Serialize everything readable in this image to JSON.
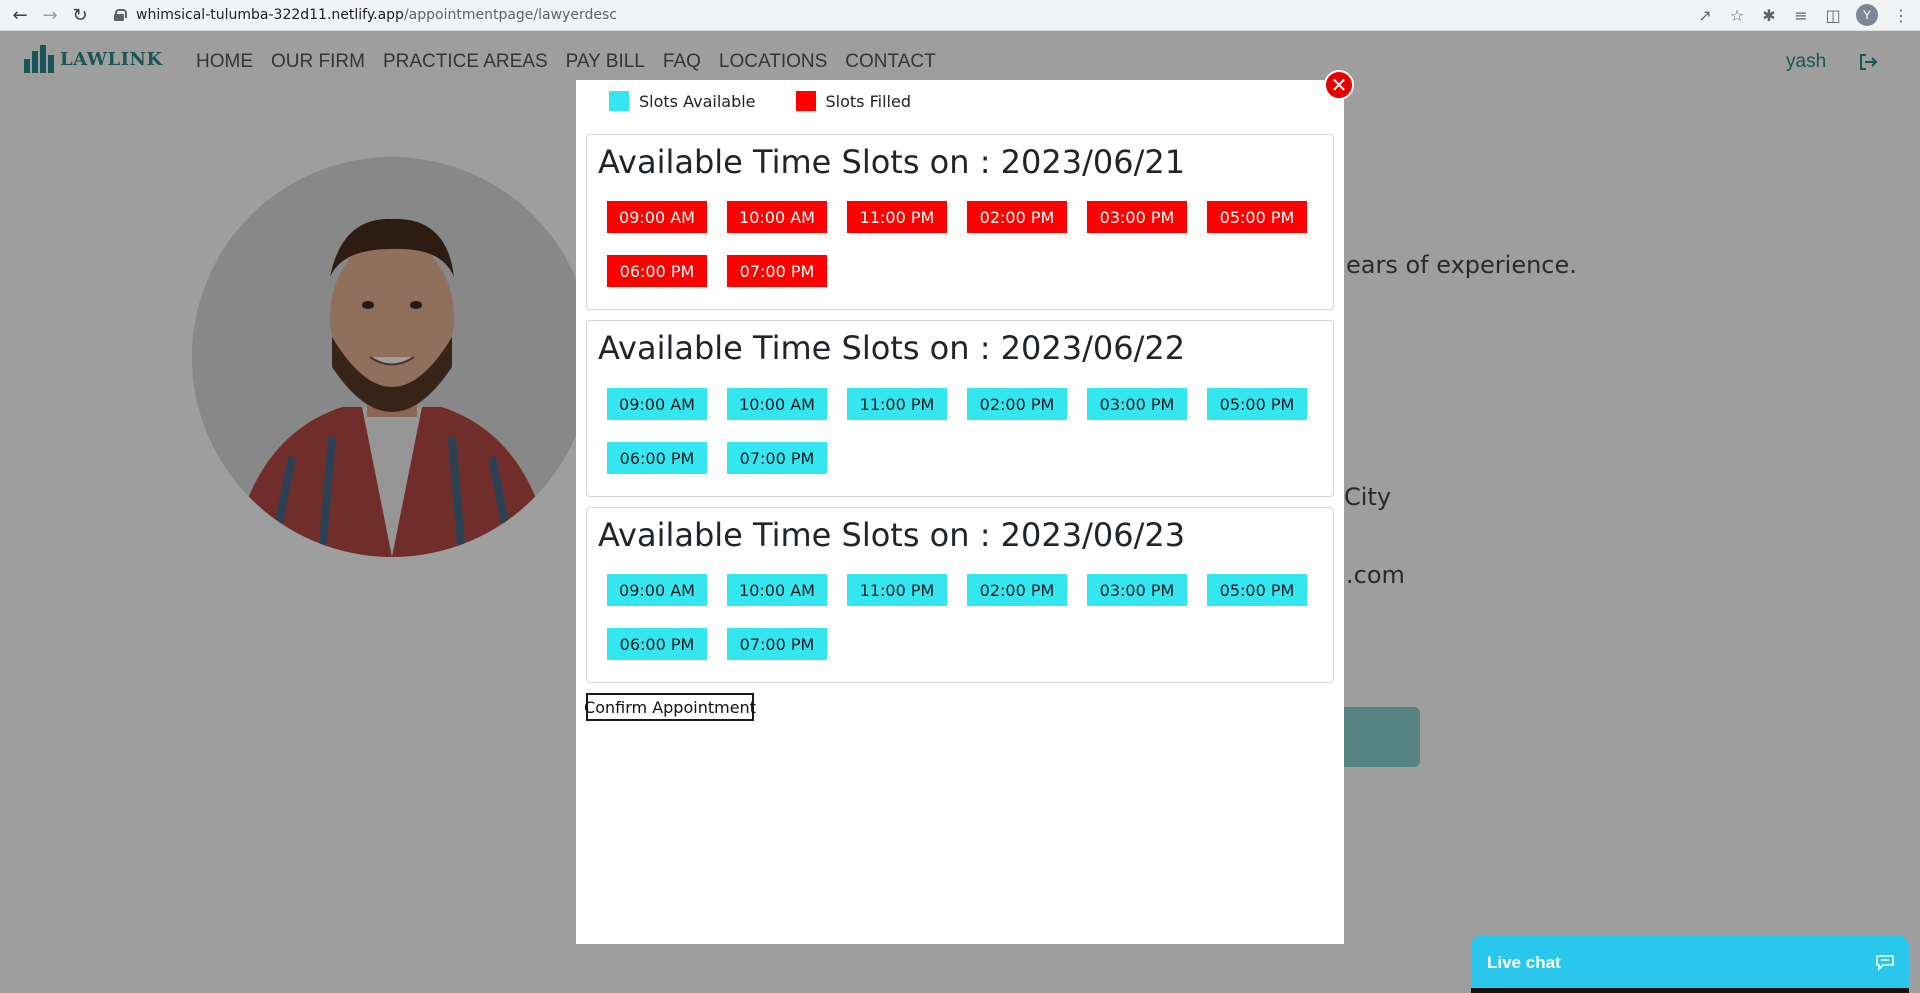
{
  "browser": {
    "url_host": "whimsical-tulumba-322d11.netlify.app",
    "url_path": "/appointmentpage/lawyerdesc",
    "profile_initial": "Y"
  },
  "site": {
    "logo_text": "LAWLINK",
    "nav": [
      "HOME",
      "OUR FIRM",
      "PRACTICE AREAS",
      "PAY BILL",
      "FAQ",
      "LOCATIONS",
      "CONTACT"
    ],
    "user_name": "yash",
    "background_snippets": {
      "experience": "ears of experience.",
      "city": "City",
      "email": ".com"
    }
  },
  "modal": {
    "legend": {
      "available_label": "Slots Available",
      "filled_label": "Slots Filled",
      "available_color": "#33e6f0",
      "filled_color": "#ff0000"
    },
    "days": [
      {
        "title": "Available Time Slots on : 2023/06/21",
        "slots": [
          {
            "time": "09:00 AM",
            "status": "filled"
          },
          {
            "time": "10:00 AM",
            "status": "filled"
          },
          {
            "time": "11:00 PM",
            "status": "filled"
          },
          {
            "time": "02:00 PM",
            "status": "filled"
          },
          {
            "time": "03:00 PM",
            "status": "filled"
          },
          {
            "time": "05:00 PM",
            "status": "filled"
          },
          {
            "time": "06:00 PM",
            "status": "filled"
          },
          {
            "time": "07:00 PM",
            "status": "filled"
          }
        ]
      },
      {
        "title": "Available Time Slots on : 2023/06/22",
        "slots": [
          {
            "time": "09:00 AM",
            "status": "available"
          },
          {
            "time": "10:00 AM",
            "status": "available"
          },
          {
            "time": "11:00 PM",
            "status": "available"
          },
          {
            "time": "02:00 PM",
            "status": "available"
          },
          {
            "time": "03:00 PM",
            "status": "available"
          },
          {
            "time": "05:00 PM",
            "status": "available"
          },
          {
            "time": "06:00 PM",
            "status": "available"
          },
          {
            "time": "07:00 PM",
            "status": "available"
          }
        ]
      },
      {
        "title": "Available Time Slots on : 2023/06/23",
        "slots": [
          {
            "time": "09:00 AM",
            "status": "available"
          },
          {
            "time": "10:00 AM",
            "status": "available"
          },
          {
            "time": "11:00 PM",
            "status": "available"
          },
          {
            "time": "02:00 PM",
            "status": "available"
          },
          {
            "time": "03:00 PM",
            "status": "available"
          },
          {
            "time": "05:00 PM",
            "status": "available"
          },
          {
            "time": "06:00 PM",
            "status": "available"
          },
          {
            "time": "07:00 PM",
            "status": "available"
          }
        ]
      }
    ],
    "confirm_label": "Confirm Appointment",
    "close_glyph": "✕"
  },
  "live_chat": {
    "label": "Live chat",
    "color": "#29c7ec"
  }
}
